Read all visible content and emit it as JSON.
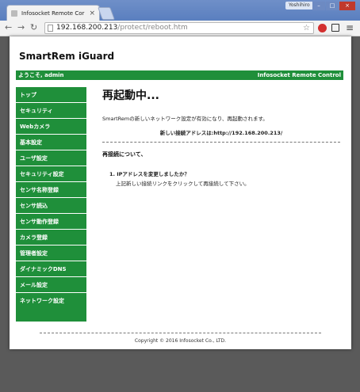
{
  "browser": {
    "tab_title": "Infosocket Remote Cor",
    "window_user": "Yoshihiro",
    "url_host": "192.168.200.213",
    "url_path": "/protect/reboot.htm"
  },
  "header": {
    "brand": "SmartRem iGuard",
    "welcome": "ようこそ, admin",
    "company": "Infosocket Remote Control"
  },
  "sidebar": {
    "items": [
      {
        "label": "トップ"
      },
      {
        "label": "セキュリティ"
      },
      {
        "label": "Webカメラ"
      },
      {
        "label": "基本設定"
      },
      {
        "label": "ユーザ設定"
      },
      {
        "label": "セキュリティ設定"
      },
      {
        "label": "センサ名称登録"
      },
      {
        "label": "センサ読込"
      },
      {
        "label": "センサ動作登録"
      },
      {
        "label": "カメラ登録"
      },
      {
        "label": "管理者設定"
      },
      {
        "label": "ダイナミックDNS"
      },
      {
        "label": "メール設定"
      },
      {
        "label": "ネットワーク設定"
      }
    ]
  },
  "main": {
    "title": "再起動中...",
    "description": "SmartRemの新しいネットワーク設定が有効になり、再起動されます。",
    "new_address_label": "新しい接続アドレスは:",
    "new_address_url": "http://192.168.200.213/",
    "reconnect_heading": "再接続について、",
    "faq": [
      {
        "question": "1. IPアドレスを変更しましたか？",
        "answer": "上記新しい接続リンクをクリックして再接続して下さい。"
      }
    ]
  },
  "footer": {
    "copyright": "Copyright © 2016 Infosocket Co., LTD."
  },
  "colors": {
    "brand_green": "#1f8f3a",
    "page_bg": "#ffffff",
    "desktop_bg": "#5a5a5a"
  }
}
